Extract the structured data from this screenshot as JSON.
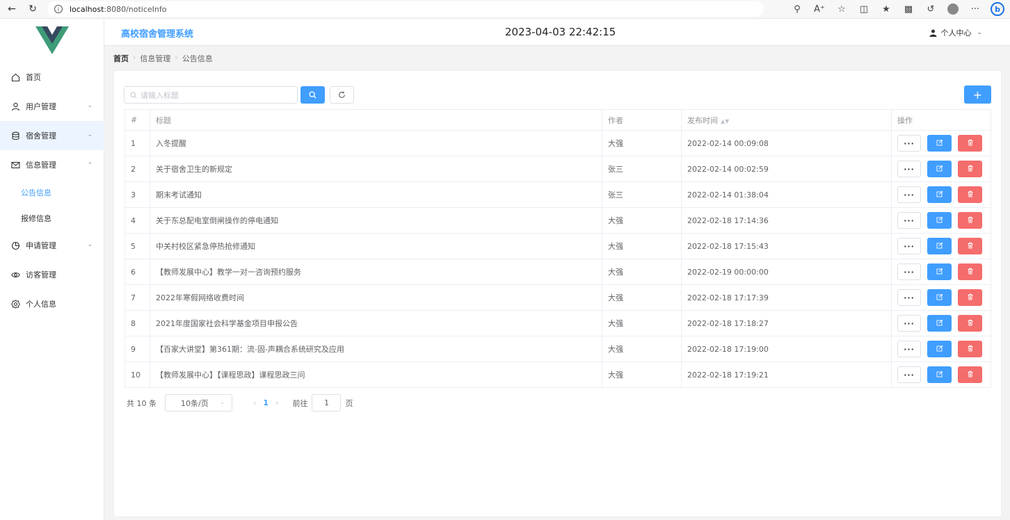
{
  "browser": {
    "url_host": "localhost",
    "url_rest": ":8080/noticeInfo"
  },
  "sidebar": {
    "items": [
      {
        "label": "首页",
        "icon": "home-icon"
      },
      {
        "label": "用户管理",
        "icon": "user-icon"
      },
      {
        "label": "宿舍管理",
        "icon": "database-icon"
      },
      {
        "label": "信息管理",
        "icon": "mail-icon"
      },
      {
        "label": "申请管理",
        "icon": "clock-icon"
      },
      {
        "label": "访客管理",
        "icon": "eye-icon"
      },
      {
        "label": "个人信息",
        "icon": "gear-icon"
      }
    ],
    "sub_items": [
      {
        "label": "公告信息"
      },
      {
        "label": "报修信息"
      }
    ]
  },
  "header": {
    "system_title": "高校宿舍管理系统",
    "datetime": "2023-04-03 22:42:15",
    "user_center": "个人中心"
  },
  "breadcrumb": [
    "首页",
    "信息管理",
    "公告信息"
  ],
  "toolbar": {
    "search_placeholder": "请输入标题",
    "add_label": "+"
  },
  "table": {
    "headers": [
      "#",
      "标题",
      "作者",
      "发布时间",
      "操作"
    ],
    "rows": [
      {
        "idx": "1",
        "title": "入冬提醒",
        "author": "大强",
        "time": "2022-02-14 00:09:08"
      },
      {
        "idx": "2",
        "title": "关于宿舍卫生的新规定",
        "author": "张三",
        "time": "2022-02-14 00:02:59"
      },
      {
        "idx": "3",
        "title": "期末考试通知",
        "author": "张三",
        "time": "2022-02-14 01:38:04"
      },
      {
        "idx": "4",
        "title": "关于东总配电室倒闸操作的停电通知",
        "author": "大强",
        "time": "2022-02-18 17:14:36"
      },
      {
        "idx": "5",
        "title": "中关村校区紧急停热抢修通知",
        "author": "大强",
        "time": "2022-02-18 17:15:43"
      },
      {
        "idx": "6",
        "title": "【教师发展中心】教学一对一咨询预约服务",
        "author": "大强",
        "time": "2022-02-19 00:00:00"
      },
      {
        "idx": "7",
        "title": "2022年寒假网络收费时间",
        "author": "大强",
        "time": "2022-02-18 17:17:39"
      },
      {
        "idx": "8",
        "title": "2021年度国家社会科学基金项目申报公告",
        "author": "大强",
        "time": "2022-02-18 17:18:27"
      },
      {
        "idx": "9",
        "title": "【百家大讲堂】第361期：流-固-声耦合系统研究及应用",
        "author": "大强",
        "time": "2022-02-18 17:19:00"
      },
      {
        "idx": "10",
        "title": "【教师发展中心】【课程思政】课程思政三问",
        "author": "大强",
        "time": "2022-02-18 17:19:21"
      }
    ],
    "more_label": "···"
  },
  "pagination": {
    "total": "共 10 条",
    "page_size": "10条/页",
    "current_page": "1",
    "goto_label": "前往",
    "goto_value": "1",
    "goto_suffix": "页"
  },
  "colors": {
    "primary": "#409eff",
    "danger": "#f56c6c"
  }
}
